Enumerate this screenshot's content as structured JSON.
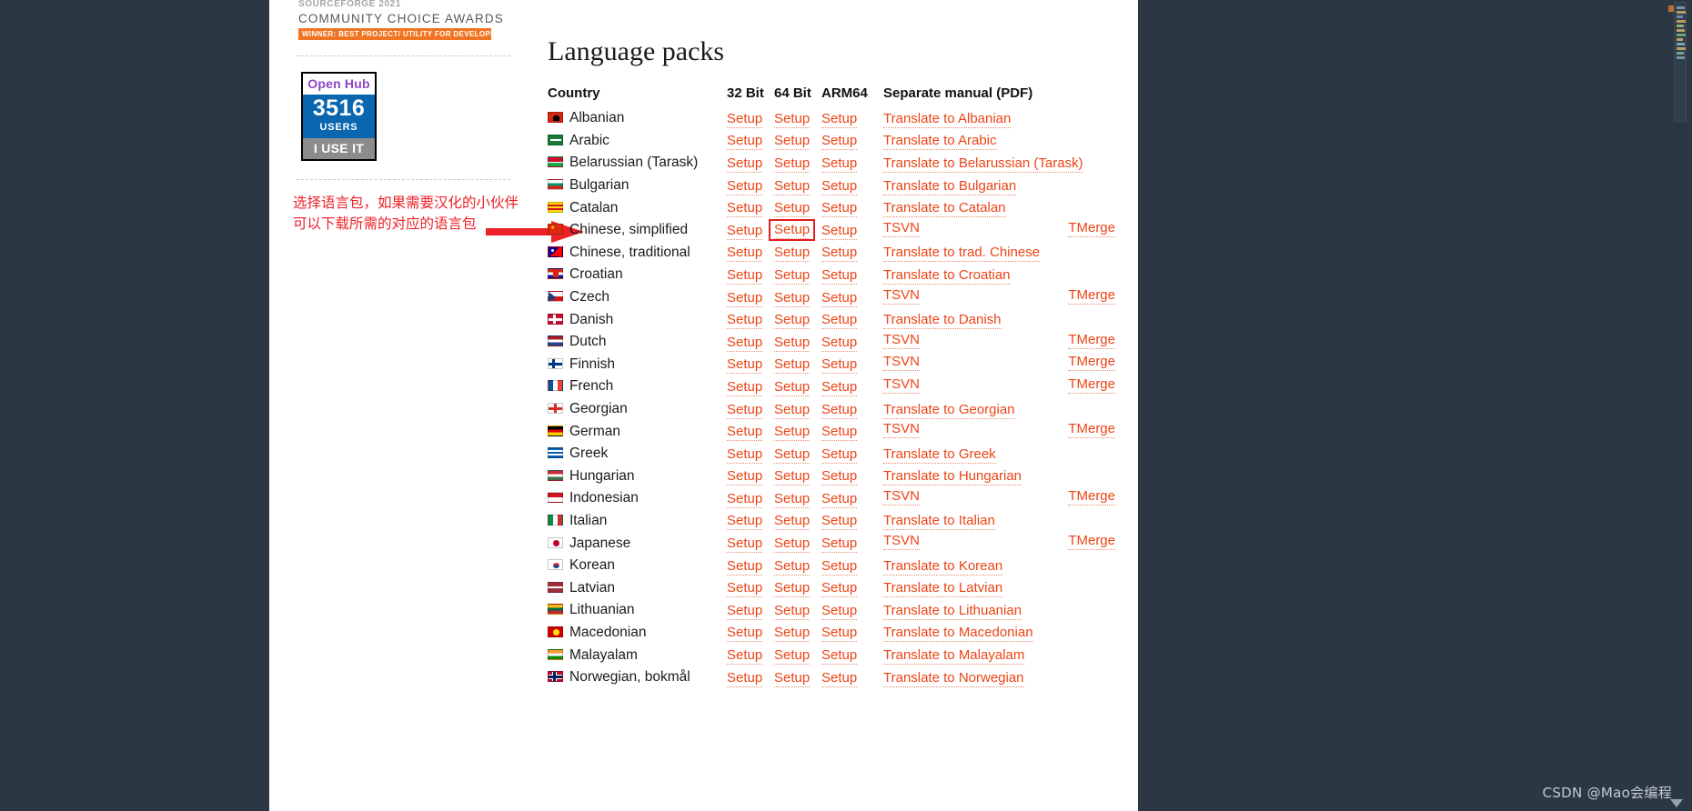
{
  "award": {
    "line1": "SOURCEFORGE 2021",
    "line2": "COMMUNITY  CHOICE  AWARDS",
    "ribbon": "WINNER: BEST PROJECT/ UTILITY FOR DEVELOPERS"
  },
  "openhub": {
    "title": "Open Hub",
    "count": "3516",
    "users_label": "USERS",
    "cta": "I USE IT"
  },
  "annotation": {
    "line1": "选择语言包，如果需要汉化的小伙伴",
    "line2": "可以下载所需的对应的语言包",
    "arrow_color": "#ec2027"
  },
  "main": {
    "heading": "Language packs",
    "columns": {
      "country": "Country",
      "bit32": "32 Bit",
      "bit64": "64 Bit",
      "arm64": "ARM64",
      "manual": "Separate manual (PDF)"
    },
    "setup_label": "Setup",
    "tsvn_label": "TSVN",
    "tmerge_label": "TMerge",
    "highlight": {
      "row": "Chinese, simplified",
      "column": "64 Bit",
      "color": "#e21b1b"
    },
    "link_color": "#ec4415",
    "rows": [
      {
        "country": "Albanian",
        "flag": "albania",
        "manual": "Translate to Albanian",
        "split": false
      },
      {
        "country": "Arabic",
        "flag": "saudi",
        "manual": "Translate to Arabic",
        "split": false
      },
      {
        "country": "Belarussian (Tarask)",
        "flag": "belarus",
        "manual": "Translate to Belarussian (Tarask)",
        "split": false
      },
      {
        "country": "Bulgarian",
        "flag": "bulgaria",
        "manual": "Translate to Bulgarian",
        "split": false
      },
      {
        "country": "Catalan",
        "flag": "catalonia",
        "manual": "Translate to Catalan",
        "split": false
      },
      {
        "country": "Chinese, simplified",
        "flag": "china",
        "manual": "",
        "split": true
      },
      {
        "country": "Chinese, traditional",
        "flag": "taiwan",
        "manual": "Translate to trad. Chinese",
        "split": false
      },
      {
        "country": "Croatian",
        "flag": "croatia",
        "manual": "Translate to Croatian",
        "split": false
      },
      {
        "country": "Czech",
        "flag": "czech",
        "manual": "",
        "split": true
      },
      {
        "country": "Danish",
        "flag": "denmark",
        "manual": "Translate to Danish",
        "split": false
      },
      {
        "country": "Dutch",
        "flag": "netherlands",
        "manual": "",
        "split": true
      },
      {
        "country": "Finnish",
        "flag": "finland",
        "manual": "",
        "split": true
      },
      {
        "country": "French",
        "flag": "france",
        "manual": "",
        "split": true
      },
      {
        "country": "Georgian",
        "flag": "georgia",
        "manual": "Translate to Georgian",
        "split": false
      },
      {
        "country": "German",
        "flag": "germany",
        "manual": "",
        "split": true
      },
      {
        "country": "Greek",
        "flag": "greece",
        "manual": "Translate to Greek",
        "split": false
      },
      {
        "country": "Hungarian",
        "flag": "hungary",
        "manual": "Translate to Hungarian",
        "split": false
      },
      {
        "country": "Indonesian",
        "flag": "indonesia",
        "manual": "",
        "split": true
      },
      {
        "country": "Italian",
        "flag": "italy",
        "manual": "Translate to Italian",
        "split": false
      },
      {
        "country": "Japanese",
        "flag": "japan",
        "manual": "",
        "split": true
      },
      {
        "country": "Korean",
        "flag": "korea",
        "manual": "Translate to Korean",
        "split": false
      },
      {
        "country": "Latvian",
        "flag": "latvia",
        "manual": "Translate to Latvian",
        "split": false
      },
      {
        "country": "Lithuanian",
        "flag": "lithuania",
        "manual": "Translate to Lithuanian",
        "split": false
      },
      {
        "country": "Macedonian",
        "flag": "macedonia",
        "manual": "Translate to Macedonian",
        "split": false
      },
      {
        "country": "Malayalam",
        "flag": "india",
        "manual": "Translate to Malayalam",
        "split": false
      },
      {
        "country": "Norwegian, bokmål",
        "flag": "norway",
        "manual": "Translate to Norwegian",
        "split": false
      }
    ]
  },
  "watermark": {
    "text": "CSDN @Mao会编程"
  }
}
